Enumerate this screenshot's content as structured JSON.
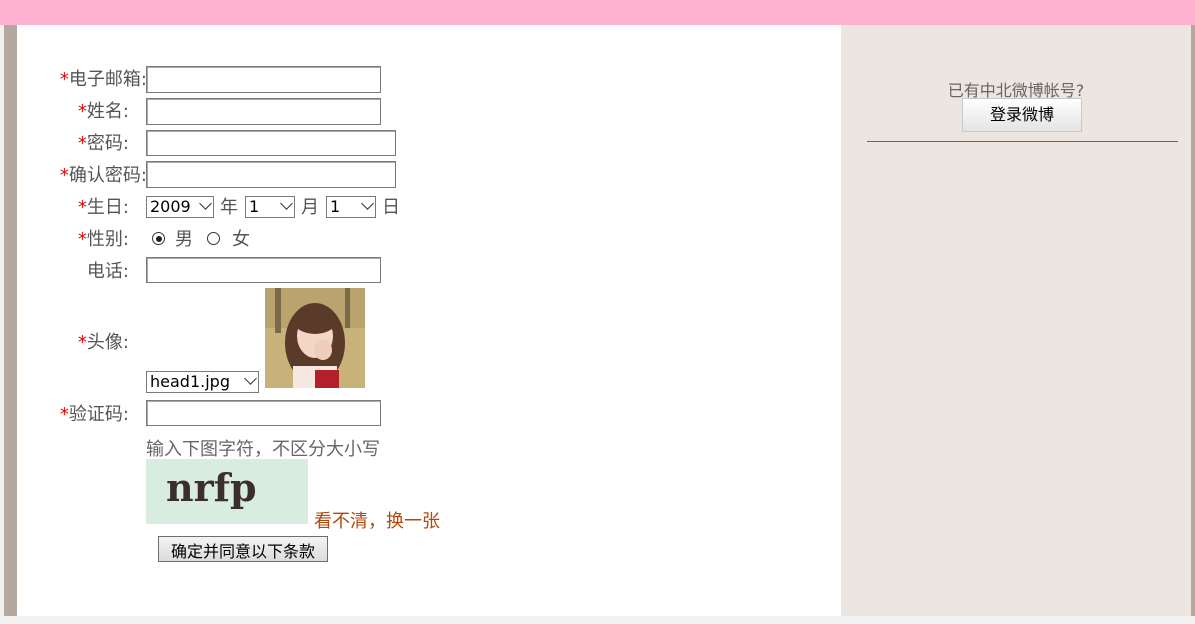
{
  "form": {
    "email_label": "电子邮箱",
    "name_label": "姓名",
    "password_label": "密码",
    "confirm_label": "确认密码",
    "birthday_label": "生日",
    "gender_label": "性别",
    "phone_label": "电话",
    "avatar_label": "头像",
    "captcha_label": "验证码",
    "required_mark": "*",
    "colon": ":",
    "year_value": "2009",
    "year_unit": "年",
    "month_value": "1",
    "month_unit": "月",
    "day_value": "1",
    "day_unit": "日",
    "gender_male": "男",
    "gender_female": "女",
    "avatar_file": "head1.jpg",
    "captcha_hint": "输入下图字符，不区分大小写",
    "captcha_text": "nrfp",
    "refresh_link": "看不清，换一张",
    "submit_label": "确定并同意以下条款"
  },
  "sidebar": {
    "prompt": "已有中北微博帐号?",
    "login_button": "登录微博"
  },
  "colors": {
    "topbar": "#ffb3d1",
    "required": "#ee0000",
    "link": "#b4470d",
    "sidebar_bg": "#ede5e0"
  }
}
